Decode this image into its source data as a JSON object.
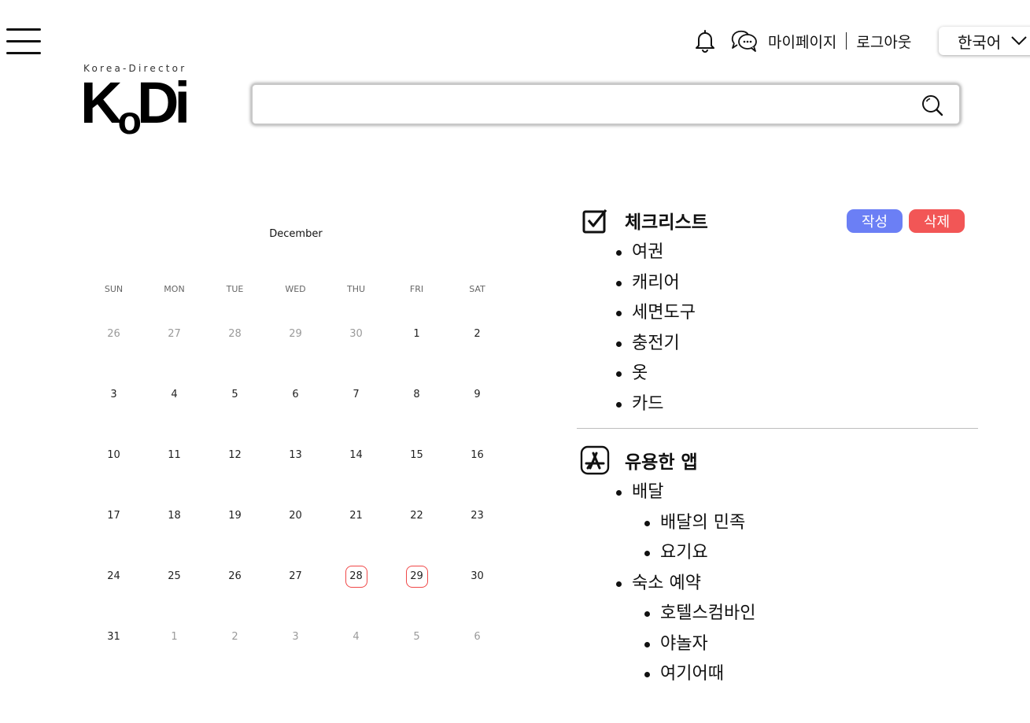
{
  "header": {
    "mypage_label": "마이페이지",
    "logout_label": "로그아웃",
    "language": {
      "selected": "한국어"
    }
  },
  "logo": {
    "tagline": "Korea-Director",
    "wordmark_k": "K",
    "wordmark_o": "o",
    "wordmark_di": "Di"
  },
  "search": {
    "value": "",
    "placeholder": ""
  },
  "calendar": {
    "month": "December",
    "weekdays": [
      "SUN",
      "MON",
      "TUE",
      "WED",
      "THU",
      "FRI",
      "SAT"
    ],
    "weeks": [
      [
        {
          "d": "26",
          "muted": true
        },
        {
          "d": "27",
          "muted": true
        },
        {
          "d": "28",
          "muted": true
        },
        {
          "d": "29",
          "muted": true
        },
        {
          "d": "30",
          "muted": true
        },
        {
          "d": "1"
        },
        {
          "d": "2"
        }
      ],
      [
        {
          "d": "3"
        },
        {
          "d": "4"
        },
        {
          "d": "5"
        },
        {
          "d": "6"
        },
        {
          "d": "7"
        },
        {
          "d": "8"
        },
        {
          "d": "9"
        }
      ],
      [
        {
          "d": "10"
        },
        {
          "d": "11"
        },
        {
          "d": "12"
        },
        {
          "d": "13"
        },
        {
          "d": "14"
        },
        {
          "d": "15"
        },
        {
          "d": "16"
        }
      ],
      [
        {
          "d": "17"
        },
        {
          "d": "18"
        },
        {
          "d": "19"
        },
        {
          "d": "20"
        },
        {
          "d": "21"
        },
        {
          "d": "22"
        },
        {
          "d": "23"
        }
      ],
      [
        {
          "d": "24"
        },
        {
          "d": "25"
        },
        {
          "d": "26"
        },
        {
          "d": "27"
        },
        {
          "d": "28",
          "marked": true
        },
        {
          "d": "29",
          "marked": true
        },
        {
          "d": "30"
        }
      ],
      [
        {
          "d": "31"
        },
        {
          "d": "1",
          "muted": true
        },
        {
          "d": "2",
          "muted": true
        },
        {
          "d": "3",
          "muted": true
        },
        {
          "d": "4",
          "muted": true
        },
        {
          "d": "5",
          "muted": true
        },
        {
          "d": "6",
          "muted": true
        }
      ]
    ],
    "marker_color": "#f04848"
  },
  "checklist": {
    "title": "체크리스트",
    "icon": "checkbox-icon",
    "write_label": "작성",
    "delete_label": "삭제",
    "write_color": "#6b7ff5",
    "delete_color": "#f25656",
    "items": [
      "여권",
      "캐리어",
      "세면도구",
      "충전기",
      "옷",
      "카드"
    ]
  },
  "apps": {
    "title": "유용한 앱",
    "icon": "app-store-icon",
    "groups": [
      {
        "label": "배달",
        "items": [
          "배달의 민족",
          "요기요"
        ]
      },
      {
        "label": "숙소 예약",
        "items": [
          "호텔스컴바인",
          "야놀자",
          "여기어때"
        ]
      }
    ]
  }
}
